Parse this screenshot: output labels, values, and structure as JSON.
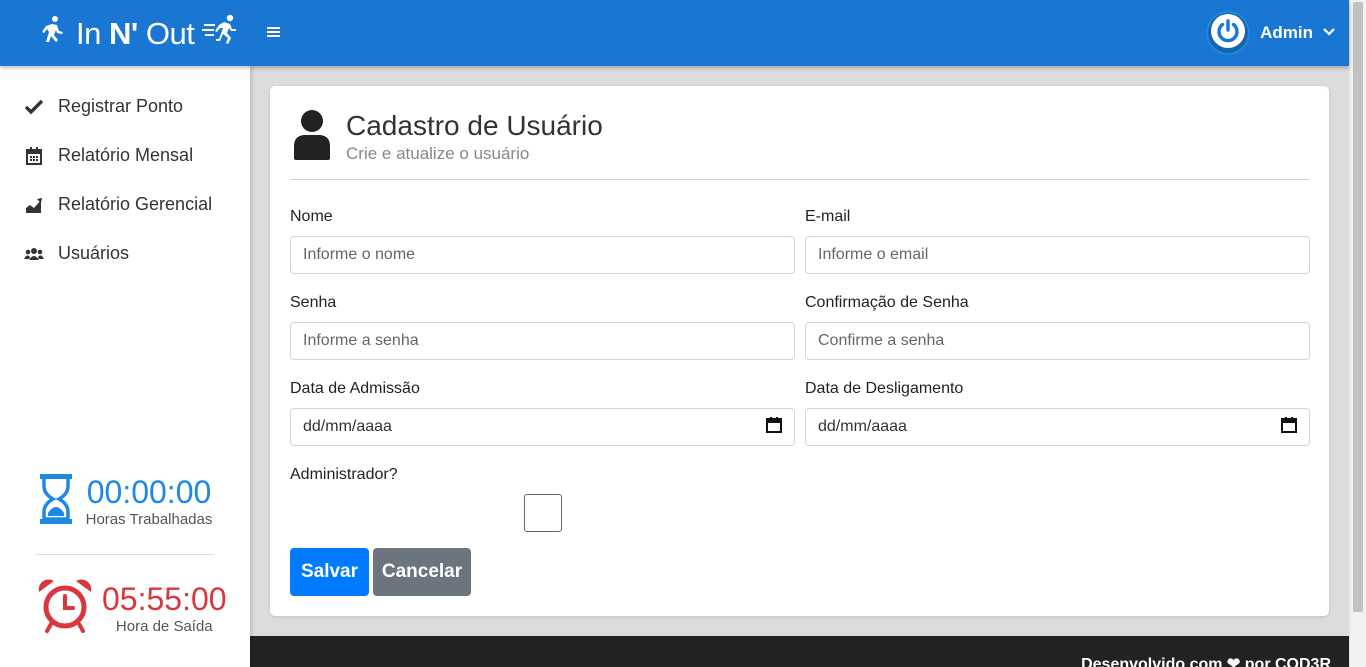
{
  "brand": {
    "name_prefix": "In ",
    "name_bold": "N'",
    "name_suffix": " Out"
  },
  "header": {
    "menu_icon": "hamburger-icon",
    "user_name": "Admin",
    "avatar_icon": "power-icon",
    "accent_color": "#1976d2"
  },
  "sidebar": {
    "items": [
      {
        "label": "Registrar Ponto",
        "icon": "check-icon"
      },
      {
        "label": "Relatório Mensal",
        "icon": "calendar-icon"
      },
      {
        "label": "Relatório Gerencial",
        "icon": "chart-area-icon"
      },
      {
        "label": "Usuários",
        "icon": "users-icon"
      }
    ],
    "worked": {
      "time": "00:00:00",
      "label": "Horas Trabalhadas",
      "color": "#1e88e5"
    },
    "exit": {
      "time": "05:55:00",
      "label": "Hora de Saída",
      "color": "#d9363e"
    }
  },
  "form": {
    "title": "Cadastro de Usuário",
    "subtitle": "Crie e atualize o usuário",
    "fields": {
      "name": {
        "label": "Nome",
        "placeholder": "Informe o nome"
      },
      "email": {
        "label": "E-mail",
        "placeholder": "Informe o email"
      },
      "password": {
        "label": "Senha",
        "placeholder": "Informe a senha"
      },
      "confirm_password": {
        "label": "Confirmação de Senha",
        "placeholder": "Confirme a senha"
      },
      "start_date": {
        "label": "Data de Admissão",
        "placeholder": "dd/mm/aaaa"
      },
      "end_date": {
        "label": "Data de Desligamento",
        "placeholder": "dd/mm/aaaa"
      },
      "is_admin": {
        "label": "Administrador?",
        "checked": false
      }
    },
    "save_label": "Salvar",
    "cancel_label": "Cancelar"
  },
  "footer": {
    "text": "Desenvolvido com ❤ por COD3R"
  }
}
